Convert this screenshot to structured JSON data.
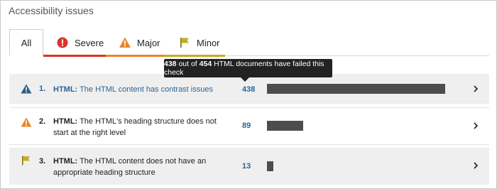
{
  "panel": {
    "title": "Accessibility issues"
  },
  "tabs": [
    {
      "label": "All",
      "active": true,
      "color": ""
    },
    {
      "label": "Severe",
      "icon": "error-circle-icon",
      "color": "#d9342b"
    },
    {
      "label": "Major",
      "icon": "warning-triangle-icon",
      "color": "#e8852b"
    },
    {
      "label": "Minor",
      "icon": "flag-icon",
      "color": "#c2ae20"
    }
  ],
  "tooltip": {
    "failed": "438",
    "mid": "out of",
    "total": "454",
    "suffix": "HTML documents have failed this check"
  },
  "issues": [
    {
      "index": "1.",
      "category": "HTML:",
      "text": "The HTML content has contrast issues",
      "count": "438",
      "fraction": 0.965,
      "severity_icon": "warning-triangle-icon",
      "icon_color": "#2a5d85"
    },
    {
      "index": "2.",
      "category": "HTML:",
      "text": "The HTML's heading structure does not start at the right level",
      "count": "89",
      "fraction": 0.196,
      "severity_icon": "warning-triangle-icon",
      "icon_color": "#e8852b"
    },
    {
      "index": "3.",
      "category": "HTML:",
      "text": "The HTML content does not have an appropriate heading structure",
      "count": "13",
      "fraction": 0.029,
      "severity_icon": "flag-icon",
      "icon_color": "#c2ae20"
    }
  ]
}
